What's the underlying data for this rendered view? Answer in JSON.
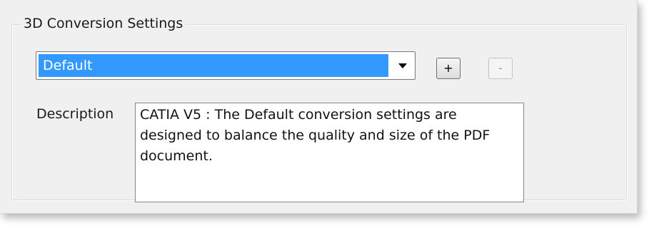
{
  "group": {
    "title": "3D Conversion Settings"
  },
  "settings_dropdown": {
    "selected": "Default"
  },
  "buttons": {
    "add_label": "+",
    "remove_label": "-"
  },
  "description": {
    "label": "Description",
    "text": "CATIA V5 : The Default conversion settings are designed to balance the quality and size of the PDF document."
  },
  "colors": {
    "selection": "#3399ff",
    "window_bg": "#f0f0f0"
  },
  "icons": {
    "dropdown": "chevron-down-icon"
  }
}
